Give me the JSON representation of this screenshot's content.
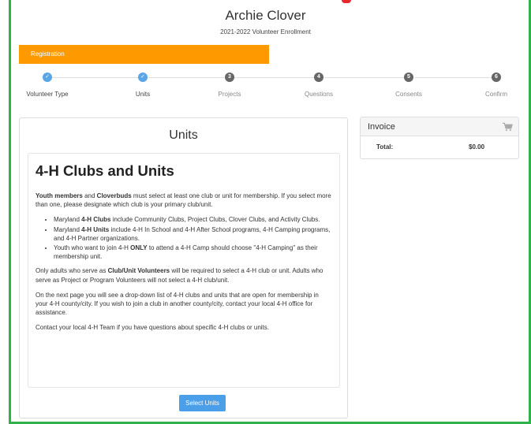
{
  "header": {
    "name": "Archie Clover",
    "subtitle": "2021-2022 Volunteer Enrollment"
  },
  "registration_bar": {
    "label": "Registration"
  },
  "steps": [
    {
      "number": "",
      "label": "Volunteer Type",
      "status": "complete"
    },
    {
      "number": "",
      "label": "Units",
      "status": "complete"
    },
    {
      "number": "3",
      "label": "Projects",
      "status": "upcoming"
    },
    {
      "number": "4",
      "label": "Questions",
      "status": "upcoming"
    },
    {
      "number": "5",
      "label": "Consents",
      "status": "upcoming"
    },
    {
      "number": "6",
      "label": "Confirm",
      "status": "upcoming"
    }
  ],
  "units": {
    "title": "Units",
    "heading": "4-H Clubs and Units",
    "intro": {
      "bold1": "Youth members",
      "text1": " and ",
      "bold2": "Cloverbuds",
      "text2": " must select at least one club or unit for membership.  If you select more than one, please designate which club is your primary club/unit."
    },
    "bullets": [
      {
        "pre": "Maryland ",
        "bold": "4-H Clubs",
        "post": " include Community Clubs, Project Clubs, Clover Clubs, and Activity Clubs."
      },
      {
        "pre": "Maryland ",
        "bold": "4-H Units",
        "post": " include 4-H In School and 4-H After School programs, 4-H Camping programs, and 4-H Partner organizations."
      },
      {
        "pre": "Youth who want to join 4-H ",
        "bold": "ONLY",
        "post": " to attend a 4-H Camp should choose \"4-H Camping\" as their membership unit."
      }
    ],
    "adults": {
      "pre": "Only adults who serve as ",
      "bold": "Club/Unit Volunteers",
      "post": " will be required to select a 4-H club or unit.  Adults who serve as Project or Program Volunteers will not select a 4-H club/unit."
    },
    "next_page": "On the next page you will see a drop-down list of 4-H clubs and units that are open for membership in your 4-H county/city.  If you wish to join a club in another county/city, contact your local 4-H office for assistance.",
    "contact": "Contact your local 4-H Team if you have questions about specific 4-H clubs or units.",
    "select_button": "Select Units"
  },
  "invoice": {
    "title": "Invoice",
    "icon": "shopping-cart-icon",
    "total_label": "Total:",
    "total_value": "$0.00"
  },
  "colors": {
    "frame_green": "#2fb24a",
    "registration_orange": "#ff9900",
    "step_complete_blue": "#5aa5e6",
    "button_blue": "#4a9fe8"
  }
}
